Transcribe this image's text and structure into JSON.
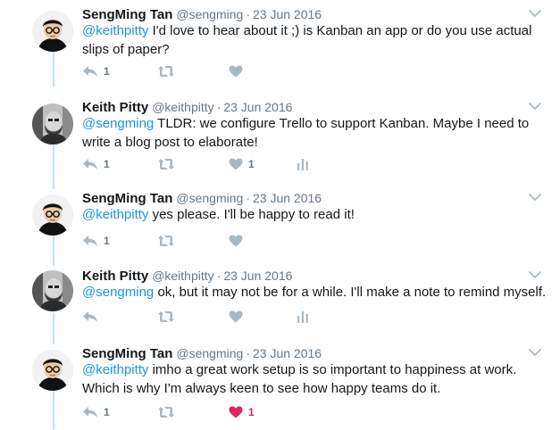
{
  "tweets": [
    {
      "name": "SengMing Tan",
      "handle": "@sengming",
      "dot": "·",
      "date": "23 Jun 2016",
      "mention": "@keithpitty",
      "body": " I'd love to hear about it ;) is Kanban an app or do you use actual slips of paper?",
      "reply_count": "1",
      "retweet_count": "",
      "like_count": "",
      "avatar": "sengming-avatar",
      "liked": false,
      "has_analytics": false
    },
    {
      "name": "Keith Pitty",
      "handle": "@keithpitty",
      "dot": "·",
      "date": "23 Jun 2016",
      "mention": "@sengming",
      "body": " TLDR: we configure Trello to support Kanban. Maybe I need to write a blog post to elaborate!",
      "reply_count": "1",
      "retweet_count": "",
      "like_count": "1",
      "avatar": "keithpitty-avatar",
      "liked": false,
      "has_analytics": true
    },
    {
      "name": "SengMing Tan",
      "handle": "@sengming",
      "dot": "·",
      "date": "23 Jun 2016",
      "mention": "@keithpitty",
      "body": " yes please. I'll be happy to read it!",
      "reply_count": "1",
      "retweet_count": "",
      "like_count": "",
      "avatar": "sengming-avatar",
      "liked": false,
      "has_analytics": false
    },
    {
      "name": "Keith Pitty",
      "handle": "@keithpitty",
      "dot": "·",
      "date": "23 Jun 2016",
      "mention": "@sengming",
      "body": " ok, but it may not be for a while. I'll make a note to remind myself.",
      "reply_count": "",
      "retweet_count": "",
      "like_count": "",
      "avatar": "keithpitty-avatar",
      "liked": false,
      "has_analytics": true
    },
    {
      "name": "SengMing Tan",
      "handle": "@sengming",
      "dot": "·",
      "date": "23 Jun 2016",
      "mention": "@keithpitty",
      "body": " imho a great work setup is so important to happiness at work. Which is why I'm always keen to see how happy teams do it.",
      "reply_count": "1",
      "retweet_count": "",
      "like_count": "1",
      "avatar": "sengming-avatar",
      "liked": true,
      "has_analytics": false
    }
  ],
  "icons": {
    "reply": "reply-icon",
    "retweet": "retweet-icon",
    "like": "heart-icon",
    "analytics": "analytics-icon",
    "caret": "chevron-down-icon"
  },
  "colors": {
    "text": "#14171a",
    "muted": "#657786",
    "icon": "#aab8c2",
    "link": "#1b95e0",
    "liked": "#e0245e",
    "thread_line": "#c4e0f3"
  }
}
